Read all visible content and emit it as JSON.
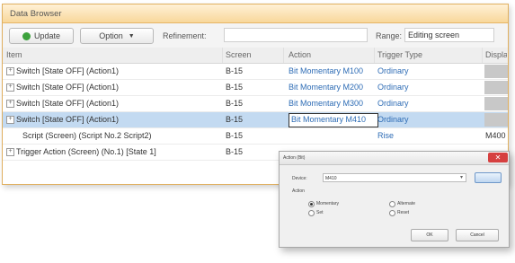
{
  "window": {
    "title": "Data Browser"
  },
  "toolbar": {
    "update_label": "Update",
    "option_label": "Option",
    "refinement_label": "Refinement:",
    "refinement_value": "",
    "range_label": "Range:",
    "range_value": "Editing screen"
  },
  "columns": [
    "Item",
    "Screen",
    "Action",
    "Trigger Type",
    "Displa"
  ],
  "rows": [
    {
      "expand": "+",
      "item": "Switch [State OFF] (Action1)",
      "screen": "B-15",
      "action": "Bit Momentary M100",
      "trigger": "Ordinary"
    },
    {
      "expand": "+",
      "item": "Switch [State OFF] (Action1)",
      "screen": "B-15",
      "action": "Bit Momentary M200",
      "trigger": "Ordinary"
    },
    {
      "expand": "+",
      "item": "Switch [State OFF] (Action1)",
      "screen": "B-15",
      "action": "Bit Momentary M300",
      "trigger": "Ordinary"
    },
    {
      "expand": "+",
      "item": "Switch [State OFF] (Action1)",
      "screen": "B-15",
      "action": "Bit Momentary M410",
      "trigger": "Ordinary"
    },
    {
      "expand": "",
      "item": "Script (Screen) (Script No.2 Script2)",
      "screen": "B-15",
      "action": "",
      "trigger": "Rise",
      "disp": "M400"
    },
    {
      "expand": "+",
      "item": "Trigger Action (Screen) (No.1) [State 1]",
      "screen": "B-15",
      "action": "",
      "trigger": "",
      "disp": ""
    }
  ],
  "dialog": {
    "title": "Action (Bit)",
    "device_label": "Device:",
    "device_value": "M410",
    "action_label": "Action",
    "opt_momentary": "Momentary",
    "opt_alternate": "Alternate",
    "opt_set": "Set",
    "opt_reset": "Reset",
    "ok_label": "OK",
    "cancel_label": "Cancel",
    "close_glyph": "✕"
  },
  "icons": {
    "update": "update-icon",
    "dropdown": "chevron-down-icon",
    "expander": "plus-box-icon"
  },
  "colors": {
    "title_bg": "#f8d79a",
    "selected_row": "#c3daf1",
    "link": "#2e6cb5",
    "close": "#d64040"
  }
}
